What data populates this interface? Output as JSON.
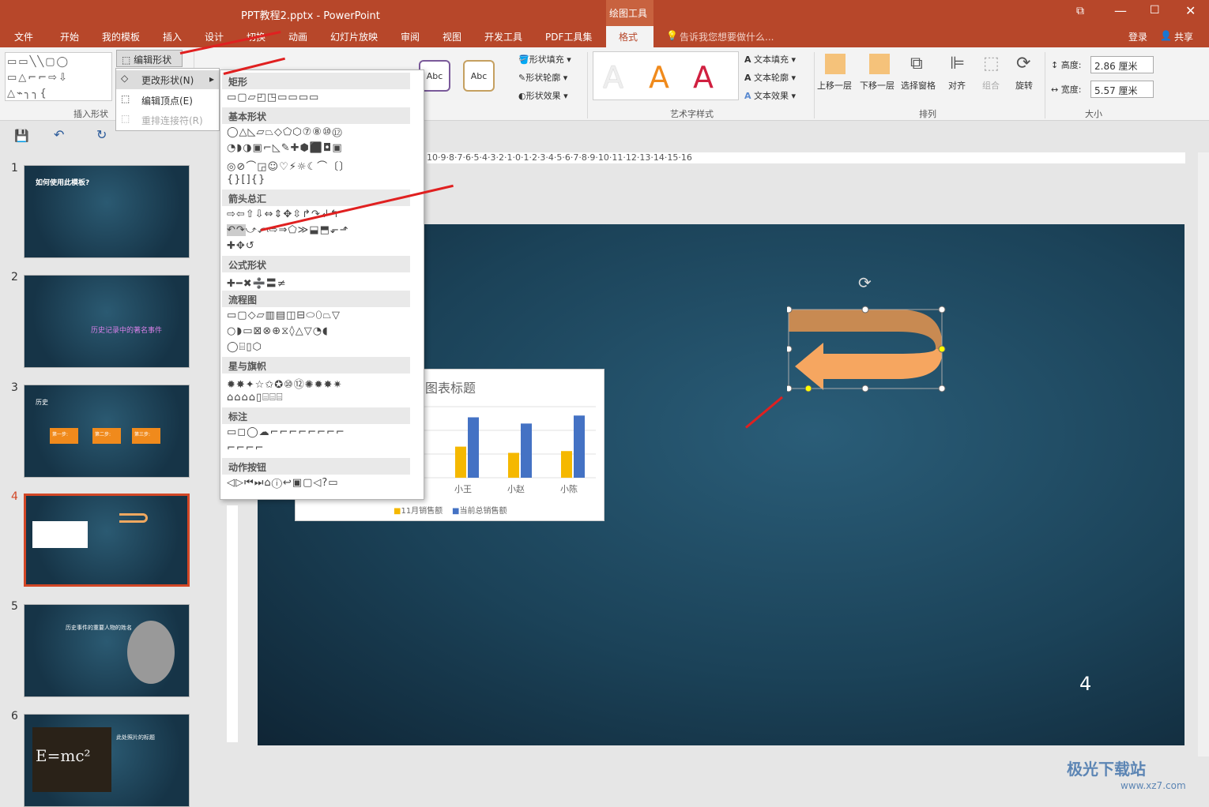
{
  "window": {
    "title": "PPT教程2.pptx - PowerPoint",
    "context_tab": "绘图工具"
  },
  "tabs": [
    "文件",
    "开始",
    "我的模板",
    "插入",
    "设计",
    "切换",
    "动画",
    "幻灯片放映",
    "审阅",
    "视图",
    "开发工具",
    "PDF工具集",
    "格式"
  ],
  "tell_me": "告诉我您想要做什么...",
  "account": {
    "login": "登录",
    "share": "共享"
  },
  "ribbon": {
    "insert_shapes_label": "插入形状",
    "edit_shape": "编辑形状",
    "shape_fill": "形状填充",
    "shape_outline": "形状轮廓",
    "shape_effect": "形状效果",
    "abc": "Abc",
    "wordart_label": "艺术字样式",
    "text_fill": "文本填充",
    "text_outline": "文本轮廓",
    "text_effect": "文本效果",
    "bring_forward": "上移一层",
    "send_backward": "下移一层",
    "selection_pane": "选择窗格",
    "align": "对齐",
    "group": "组合",
    "rotate": "旋转",
    "arrange_label": "排列",
    "height_label": "高度:",
    "height_value": "2.86 厘米",
    "width_label": "宽度:",
    "width_value": "5.57 厘米",
    "size_label": "大小"
  },
  "edit_menu": {
    "change_shape": "更改形状(N)",
    "edit_points": "编辑顶点(E)",
    "reroute": "重排连接符(R)"
  },
  "shape_gallery": {
    "categories": [
      "矩形",
      "基本形状",
      "箭头总汇",
      "公式形状",
      "流程图",
      "星与旗帜",
      "标注",
      "动作按钮"
    ]
  },
  "ruler_h": "10·9·8·7·6·5·4·3·2·1·0·1·2·3·4·5·6·7·8·9·10·11·12·13·14·15·16",
  "slides": [
    {
      "num": "1",
      "title": "如何使用此模板?"
    },
    {
      "num": "2",
      "title": "历史记录中的著名事件"
    },
    {
      "num": "3",
      "title": "历史",
      "steps": [
        "第一步:",
        "第二步:",
        "第三步:"
      ]
    },
    {
      "num": "4"
    },
    {
      "num": "5",
      "title": "历史事件的重要人物的姓名"
    },
    {
      "num": "6",
      "title": "此处照片的标题",
      "eq": "E=mc²"
    }
  ],
  "chart": {
    "title": "图表标题",
    "legend": [
      "11月销售额",
      "当前总销售额"
    ]
  },
  "chart_data": {
    "type": "bar",
    "title": "图表标题",
    "categories": [
      "小王",
      "小赵",
      "小陈"
    ],
    "series": [
      {
        "name": "11月销售额",
        "values": [
          35,
          28,
          30
        ],
        "color": "#f5b800"
      },
      {
        "name": "当前总销售额",
        "values": [
          68,
          61,
          70
        ],
        "color": "#4472c4"
      }
    ]
  },
  "slide_page_number": "4",
  "watermark": {
    "site": "极光下载站",
    "url": "www.xz7.com"
  }
}
